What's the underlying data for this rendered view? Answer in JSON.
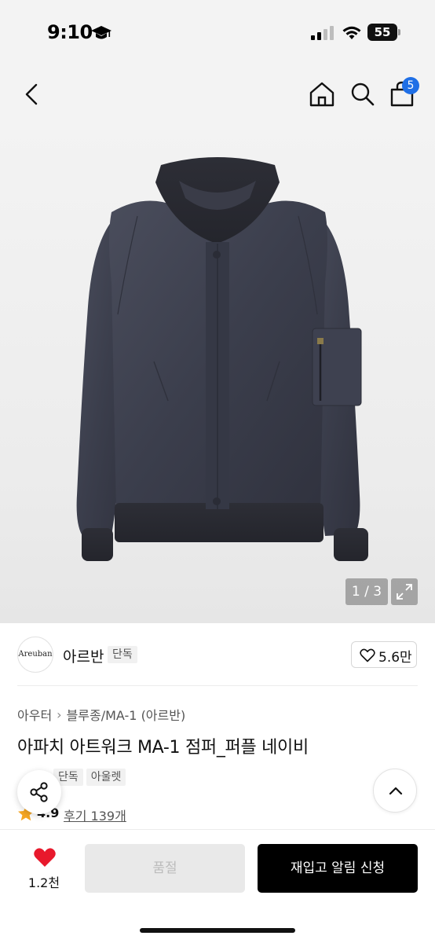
{
  "status_bar": {
    "time": "9:10",
    "battery_level": "55",
    "icons": [
      "graduation-cap-icon",
      "cellular-signal-icon",
      "wifi-icon",
      "battery-icon"
    ]
  },
  "nav": {
    "icons": [
      "chevron-left-icon",
      "home-icon",
      "search-icon",
      "shopping-bag-icon"
    ],
    "cart_count": "5",
    "badge_color": "#1f6fe6"
  },
  "gallery": {
    "counter": "1 / 3",
    "current_index": 1,
    "total": 3,
    "expand_icon": "expand-icon"
  },
  "brand": {
    "logo_text": "Areuban",
    "name": "아르반",
    "tag": "단독",
    "like_icon": "heart-outline-icon",
    "like_count": "5.6만"
  },
  "breadcrumb": {
    "items": [
      "아우터",
      "블루종/MA-1 (아르반)"
    ],
    "separator_icon": "chevron-right-icon"
  },
  "product": {
    "title": "아파치 아트워크 MA-1 점퍼_퍼플 네이비",
    "tags": [
      "단독",
      "아울렛"
    ],
    "rating": "4.9",
    "review_text": "후기 139개",
    "star_color": "#f5a623"
  },
  "floating": {
    "share_icon": "share-icon",
    "scroll_top_icon": "chevron-up-icon"
  },
  "bottom_bar": {
    "like_icon": "heart-filled-icon",
    "like_color": "#e8192c",
    "like_count": "1.2천",
    "soldout_label": "품절",
    "restock_label": "재입고 알림 신청"
  }
}
